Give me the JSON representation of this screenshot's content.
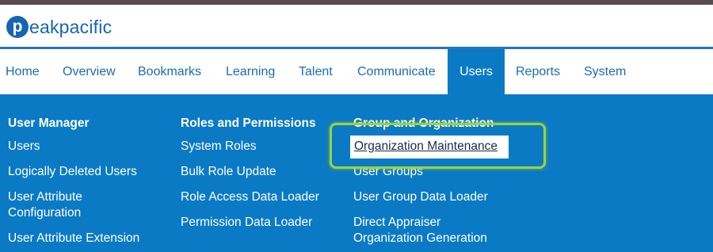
{
  "logo": {
    "mark": "p",
    "text": "eakpacific"
  },
  "nav": {
    "home": "Home",
    "overview": "Overview",
    "bookmarks": "Bookmarks",
    "learning": "Learning",
    "talent": "Talent",
    "communicate": "Communicate",
    "users": "Users",
    "reports": "Reports",
    "system": "System"
  },
  "menu": {
    "user_manager": {
      "title": "User Manager",
      "items": [
        "Users",
        "Logically Deleted Users",
        "User Attribute\nConfiguration",
        "User Attribute Extension"
      ]
    },
    "roles": {
      "title": "Roles and Permissions",
      "items": [
        "System Roles",
        "Bulk Role Update",
        "Role Access Data Loader",
        "Permission Data Loader"
      ]
    },
    "groups": {
      "title": "Group and Organization",
      "items": [
        "Organization Maintenance",
        "User Groups",
        "User Group Data Loader",
        "Direct Appraiser\nOrganization Generation"
      ]
    }
  },
  "colors": {
    "brand": "#1565b4",
    "menu_bg": "#0b7ac5",
    "callout": "#9bd23a"
  }
}
